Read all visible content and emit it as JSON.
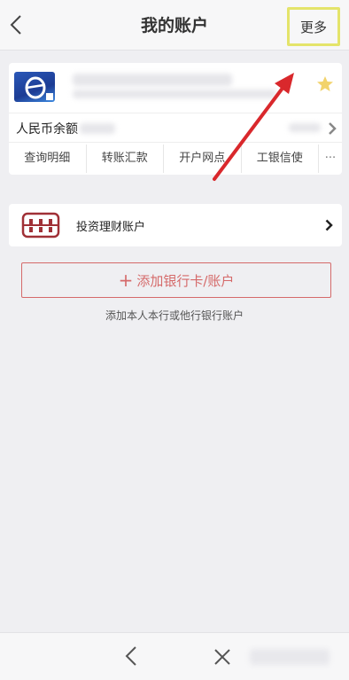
{
  "header": {
    "title": "我的账户",
    "more_label": "更多"
  },
  "card": {
    "balance_label": "人民币余额",
    "actions": [
      "查询明细",
      "转账汇款",
      "开户网点",
      "工银信使",
      "···"
    ]
  },
  "invest": {
    "label": "投资理财账户"
  },
  "add": {
    "plus": "+",
    "label": "添加银行卡/账户",
    "hint": "添加本人本行或他行银行账户"
  },
  "icons": {
    "back": "chevron-left-icon",
    "more_highlight_color": "#e4e46a",
    "annotation_arrow_color": "#d9282c",
    "accent": "#d56a6a"
  }
}
